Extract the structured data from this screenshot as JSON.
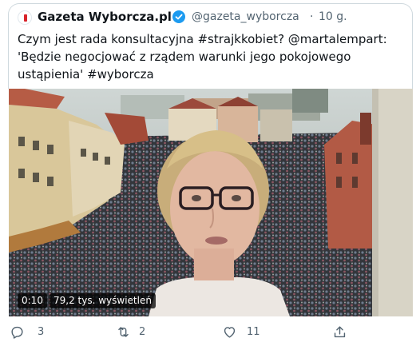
{
  "tweet": {
    "author_name": "Gazeta Wyborcza.pl",
    "handle": "@gazeta_wyborcza",
    "separator": "·",
    "time": "10 g.",
    "text_lines": [
      "Czym jest rada konsultacyjna #strajkkobiet? @martalempart:",
      "'Będzie negocjować z rządem warunki jego pokojowego",
      "ustąpienia' #wyborcza"
    ]
  },
  "video": {
    "duration": "0:10",
    "views": "79,2 tys. wyświetleń"
  },
  "actions": {
    "reply_count": "3",
    "retweet_count": "2",
    "like_count": "11"
  },
  "colors": {
    "accent": "#1d9bf0",
    "text": "#0f1419",
    "secondary": "#536471",
    "logo_red": "#d8232a"
  },
  "icons": [
    "verified-badge-icon",
    "reply-icon",
    "retweet-icon",
    "like-icon",
    "share-icon"
  ]
}
